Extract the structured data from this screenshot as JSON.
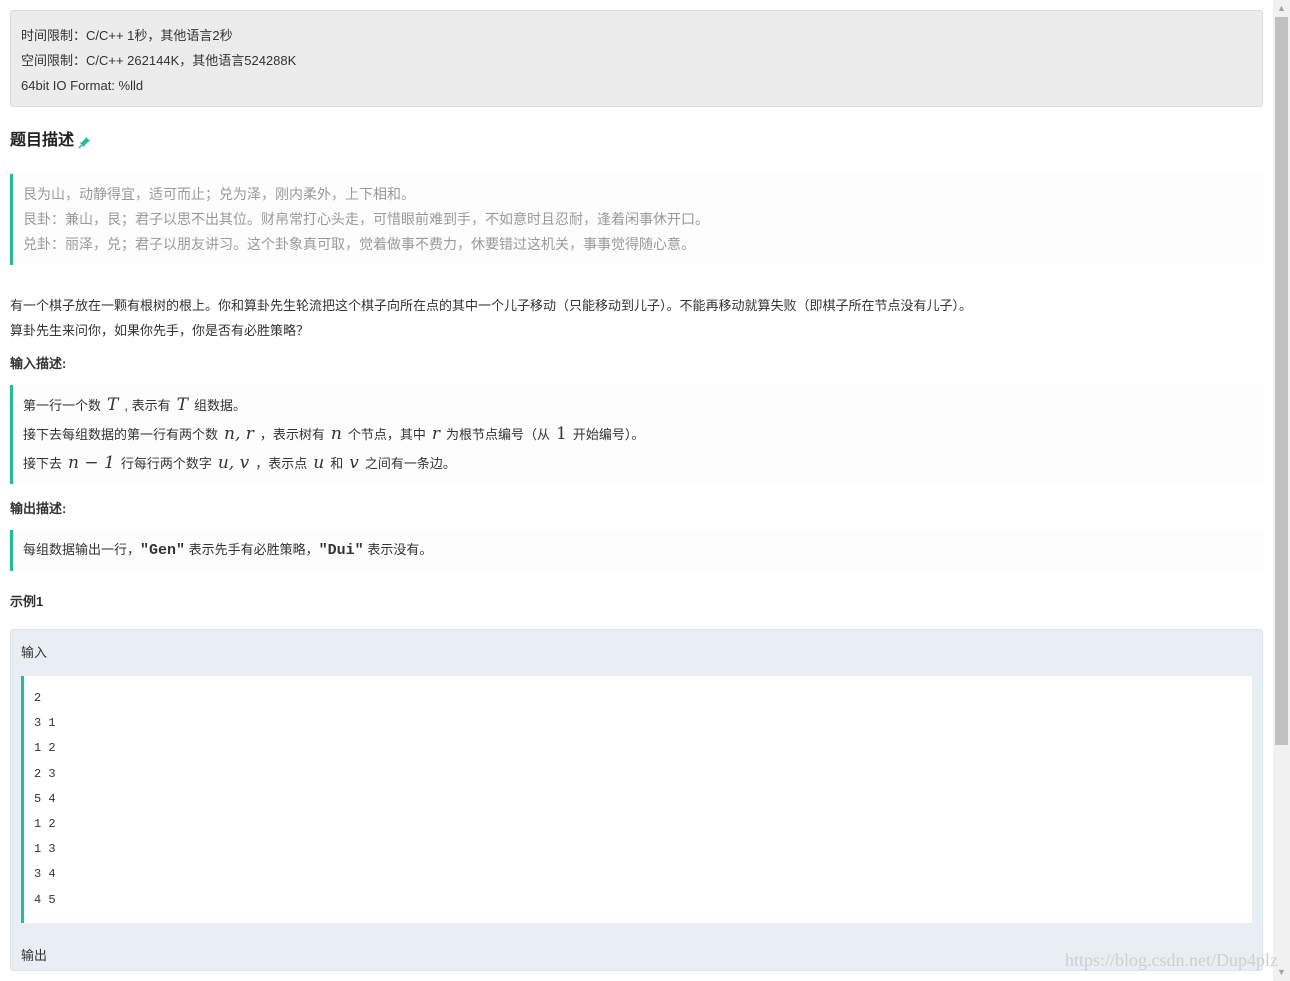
{
  "limits": {
    "time": "时间限制：C/C++ 1秒，其他语言2秒",
    "space": "空间限制：C/C++ 262144K，其他语言524288K",
    "io": "64bit IO Format: %lld"
  },
  "description": {
    "title": "题目描述",
    "poem": [
      "艮为山，动静得宜，适可而止；兑为泽，刚内柔外，上下相和。",
      "艮卦：兼山，艮；君子以思不出其位。财帛常打心头走，可惜眼前难到手，不如意时且忍耐，逢着闲事休开口。",
      "兑卦：丽泽，兑；君子以朋友讲习。这个卦象真可取，觉着做事不费力，休要错过这机关，事事觉得随心意。"
    ],
    "text1": "有一个棋子放在一颗有根树的根上。你和算卦先生轮流把这个棋子向所在点的其中一个儿子移动（只能移动到儿子）。不能再移动就算失败（即棋子所在节点没有儿子）。",
    "text2": "算卦先生来问你，如果你先手，你是否有必胜策略？"
  },
  "input": {
    "title": "输入描述:",
    "l1_a": "第一行一个数",
    "l1_m1": "T",
    "l1_b": ", 表示有",
    "l1_m2": "T",
    "l1_c": "组数据。",
    "l2_a": "接下去每组数据的第一行有两个数",
    "l2_m1": "n, r",
    "l2_b": "，表示树有",
    "l2_m2": "n",
    "l2_c": "个节点，其中",
    "l2_m3": "r",
    "l2_d": "为根节点编号（从",
    "l2_m4": "1",
    "l2_e": "开始编号）。",
    "l3_a": "接下去",
    "l3_m1": "n − 1",
    "l3_b": "行每行两个数字",
    "l3_m2": "u, v",
    "l3_c": "，表示点",
    "l3_m3": "u",
    "l3_d": "和",
    "l3_m4": "v",
    "l3_e": "之间有一条边。"
  },
  "output": {
    "title": "输出描述:",
    "a": "每组数据输出一行，",
    "gen": "\"Gen\"",
    "b": "表示先手有必胜策略，",
    "dui": "\"Dui\"",
    "c": "表示没有。"
  },
  "example": {
    "title": "示例1",
    "input_label": "输入",
    "lines": [
      "2",
      "3 1",
      "1 2",
      "2 3",
      "5 4",
      "1 2",
      "1 3",
      "3 4",
      "4 5"
    ],
    "output_label": "输出"
  },
  "watermark": "https://blog.csdn.net/Dup4plz",
  "colors": {
    "accent": "#25bb9b",
    "limits_bg": "#ececec",
    "example_bg": "#e9eef4"
  }
}
